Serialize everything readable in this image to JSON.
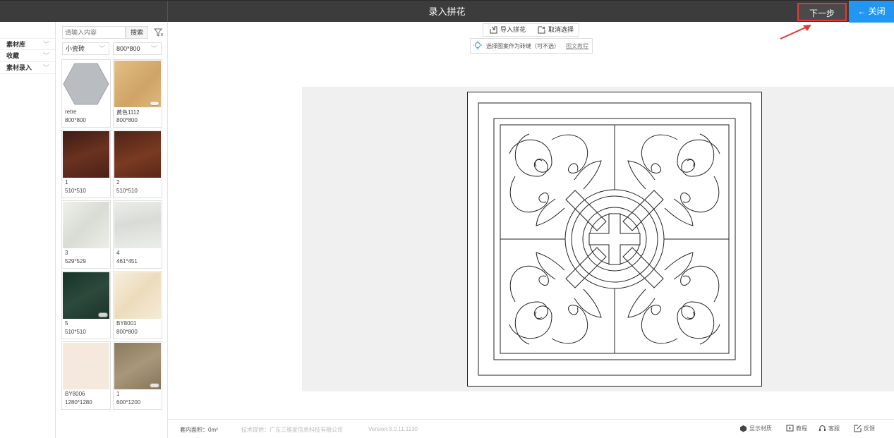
{
  "window": {
    "title": "录入拼花"
  },
  "header": {
    "next_label": "下一步",
    "close_label": "← 关闭"
  },
  "leftnav": {
    "items": [
      {
        "label": "素材库"
      },
      {
        "label": "收藏"
      },
      {
        "label": "素材录入"
      }
    ]
  },
  "panel": {
    "search_placeholder": "请输入内容",
    "search_label": "搜索",
    "filter_category": "小瓷砖",
    "filter_size": "800*800",
    "materials": [
      {
        "name": "retre",
        "size": "800*800",
        "color": "#b9bcc0"
      },
      {
        "name": "黄色1112",
        "size": "800*800",
        "color": "#d9b37a"
      },
      {
        "name": "1",
        "size": "510*510",
        "color": "#5a2a1e"
      },
      {
        "name": "2",
        "size": "510*510",
        "color": "#6b2f1c"
      },
      {
        "name": "3",
        "size": "529*529",
        "color": "#e6e8e2"
      },
      {
        "name": "4",
        "size": "461*451",
        "color": "#e4e6e2"
      },
      {
        "name": "5",
        "size": "510*510",
        "color": "#1e3d2e"
      },
      {
        "name": "BY8001",
        "size": "800*800",
        "color": "#f1e6cf"
      },
      {
        "name": "BY8006",
        "size": "1280*1280",
        "color": "#f3e8da"
      },
      {
        "name": "1",
        "size": "600*1200",
        "color": "#9c8a6c"
      }
    ]
  },
  "toolbar": {
    "import_label": "导入拼花",
    "cancel_label": "取消选择"
  },
  "hint": {
    "text": "选择图案作为砖缝（可不选）",
    "link": "图文教程"
  },
  "status": {
    "area": "套内面积：0m²",
    "tech": "技术提供：广东三维家信息科技有限公司",
    "version": "Version:3.0.11.1130",
    "show_material": "显示材质",
    "tutorial": "教程",
    "service": "客服",
    "feedback": "反馈"
  },
  "colors": {
    "accent": "#2196f3",
    "highlight": "#e53935",
    "titlebar": "#3c3c3c"
  }
}
